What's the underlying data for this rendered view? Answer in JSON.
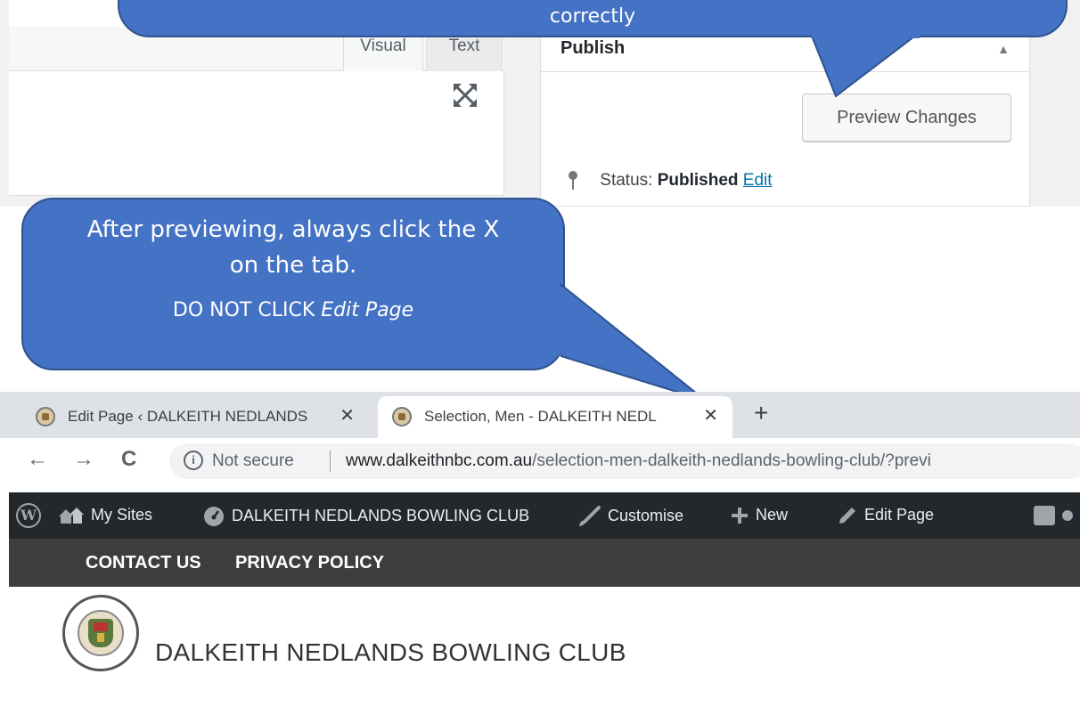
{
  "callout_top": {
    "text": "correctly"
  },
  "editor": {
    "tabs": [
      {
        "label": "Visual"
      },
      {
        "label": "Text"
      }
    ]
  },
  "publish": {
    "title": "Publish",
    "preview_button": "Preview Changes",
    "status_label": "Status:",
    "status_value": "Published",
    "edit_link": "Edit"
  },
  "callout_left": {
    "line1a": "After previewing, always click the X",
    "line1b": "on the tab.",
    "line2a": "DO NOT CLICK ",
    "line2b": "Edit Page"
  },
  "browser": {
    "tabs": [
      {
        "title": "Edit Page ‹ DALKEITH NEDLANDS",
        "close": "✕"
      },
      {
        "title": "Selection, Men - DALKEITH NEDL",
        "close": "✕"
      }
    ],
    "new_tab": "+",
    "back": "←",
    "forward": "→",
    "reload": "C",
    "security_icon_glyph": "i",
    "security_text": "Not secure",
    "url_host": "www.dalkeithnbc.com.au",
    "url_path": "/selection-men-dalkeith-nedlands-bowling-club/?previ"
  },
  "adminbar": {
    "wp_logo": "W",
    "items": [
      {
        "label": "My Sites"
      },
      {
        "label": "DALKEITH NEDLANDS BOWLING CLUB"
      },
      {
        "label": "Customise"
      },
      {
        "label": "New"
      },
      {
        "label": "Edit Page"
      }
    ]
  },
  "topnav": {
    "items": [
      {
        "label": "CONTACT US"
      },
      {
        "label": "PRIVACY POLICY"
      }
    ]
  },
  "site": {
    "title": "DALKEITH NEDLANDS BOWLING CLUB"
  },
  "colors": {
    "callout": "#4472c4",
    "adminbar": "#23282d",
    "topnav": "#3d3d3d",
    "link": "#0073aa"
  }
}
